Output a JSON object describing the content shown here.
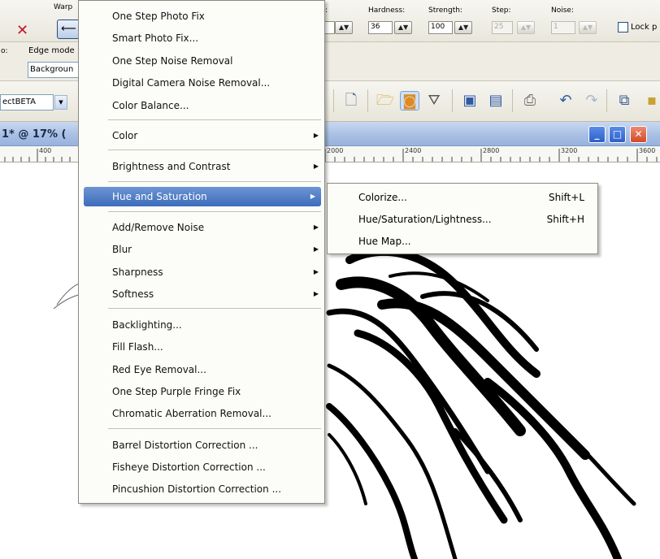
{
  "toolbar": {
    "warp_label": "Warp",
    "hardness_label": "Hardness:",
    "strength_label": "Strength:",
    "step_label": "Step:",
    "noise_label": "Noise:",
    "hardness_value": "36",
    "strength_value": "100",
    "step_value": "25",
    "noise_value": "1",
    "lock_label": "Lock p",
    "edge_mode_label": "Edge mode",
    "edge_mode_value": "Backgroun",
    "left_fragment": "o:",
    "preset_value": "ectBETA"
  },
  "document": {
    "title": "1* @ 17% (",
    "ruler_labels": [
      "400",
      "2000",
      "2400",
      "2800",
      "3200",
      "3600"
    ]
  },
  "menu": {
    "items": [
      {
        "label": "One Step Photo Fix"
      },
      {
        "label": "Smart Photo Fix..."
      },
      {
        "label": "One Step Noise Removal"
      },
      {
        "label": "Digital Camera Noise Removal..."
      },
      {
        "label": "Color Balance..."
      },
      {
        "label": "Color"
      },
      {
        "label": "Brightness and Contrast"
      },
      {
        "label": "Hue and Saturation"
      },
      {
        "label": "Add/Remove Noise"
      },
      {
        "label": "Blur"
      },
      {
        "label": "Sharpness"
      },
      {
        "label": "Softness"
      },
      {
        "label": "Backlighting..."
      },
      {
        "label": "Fill Flash..."
      },
      {
        "label": "Red Eye Removal..."
      },
      {
        "label": "One Step Purple Fringe Fix"
      },
      {
        "label": "Chromatic Aberration Removal..."
      },
      {
        "label": "Barrel Distortion Correction ..."
      },
      {
        "label": "Fisheye Distortion Correction ..."
      },
      {
        "label": "Pincushion Distortion Correction ..."
      }
    ]
  },
  "submenu": {
    "items": [
      {
        "label": "Colorize...",
        "shortcut": "Shift+L"
      },
      {
        "label": "Hue/Saturation/Lightness...",
        "shortcut": "Shift+H"
      },
      {
        "label": "Hue Map..."
      }
    ]
  },
  "colors": {
    "highlight": "#3c6cba",
    "titlebar": "#a9c0e4",
    "close_x": "#c0182a"
  },
  "icons": [
    "close-icon",
    "warp-arrow-icon",
    "new-document-icon",
    "open-folder-icon",
    "browse-icon",
    "scan-icon",
    "save-icon",
    "save-as-icon",
    "print-icon",
    "undo-icon",
    "redo-icon",
    "window-icon"
  ]
}
